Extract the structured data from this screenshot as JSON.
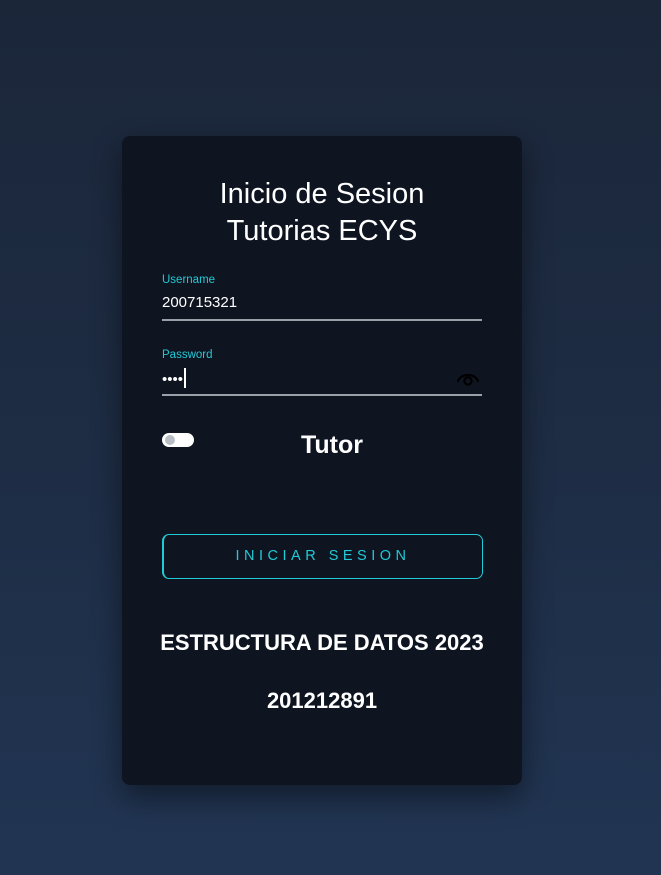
{
  "login_card": {
    "title_line1": "Inicio de Sesion",
    "title_line2": "Tutorias ECYS",
    "username": {
      "label": "Username",
      "value": "200715321"
    },
    "password": {
      "label": "Password",
      "masked_value": "••••",
      "toggle_icon": "eye-icon"
    },
    "role_toggle": {
      "label": "Tutor",
      "checked": false
    },
    "submit_label": "INICIAR SESION",
    "course_text": "ESTRUCTURA DE DATOS 2023",
    "student_id": "201212891"
  },
  "colors": {
    "accent": "#22c9d6",
    "card_background": "#0e1521",
    "page_background": "#1e2d45"
  }
}
